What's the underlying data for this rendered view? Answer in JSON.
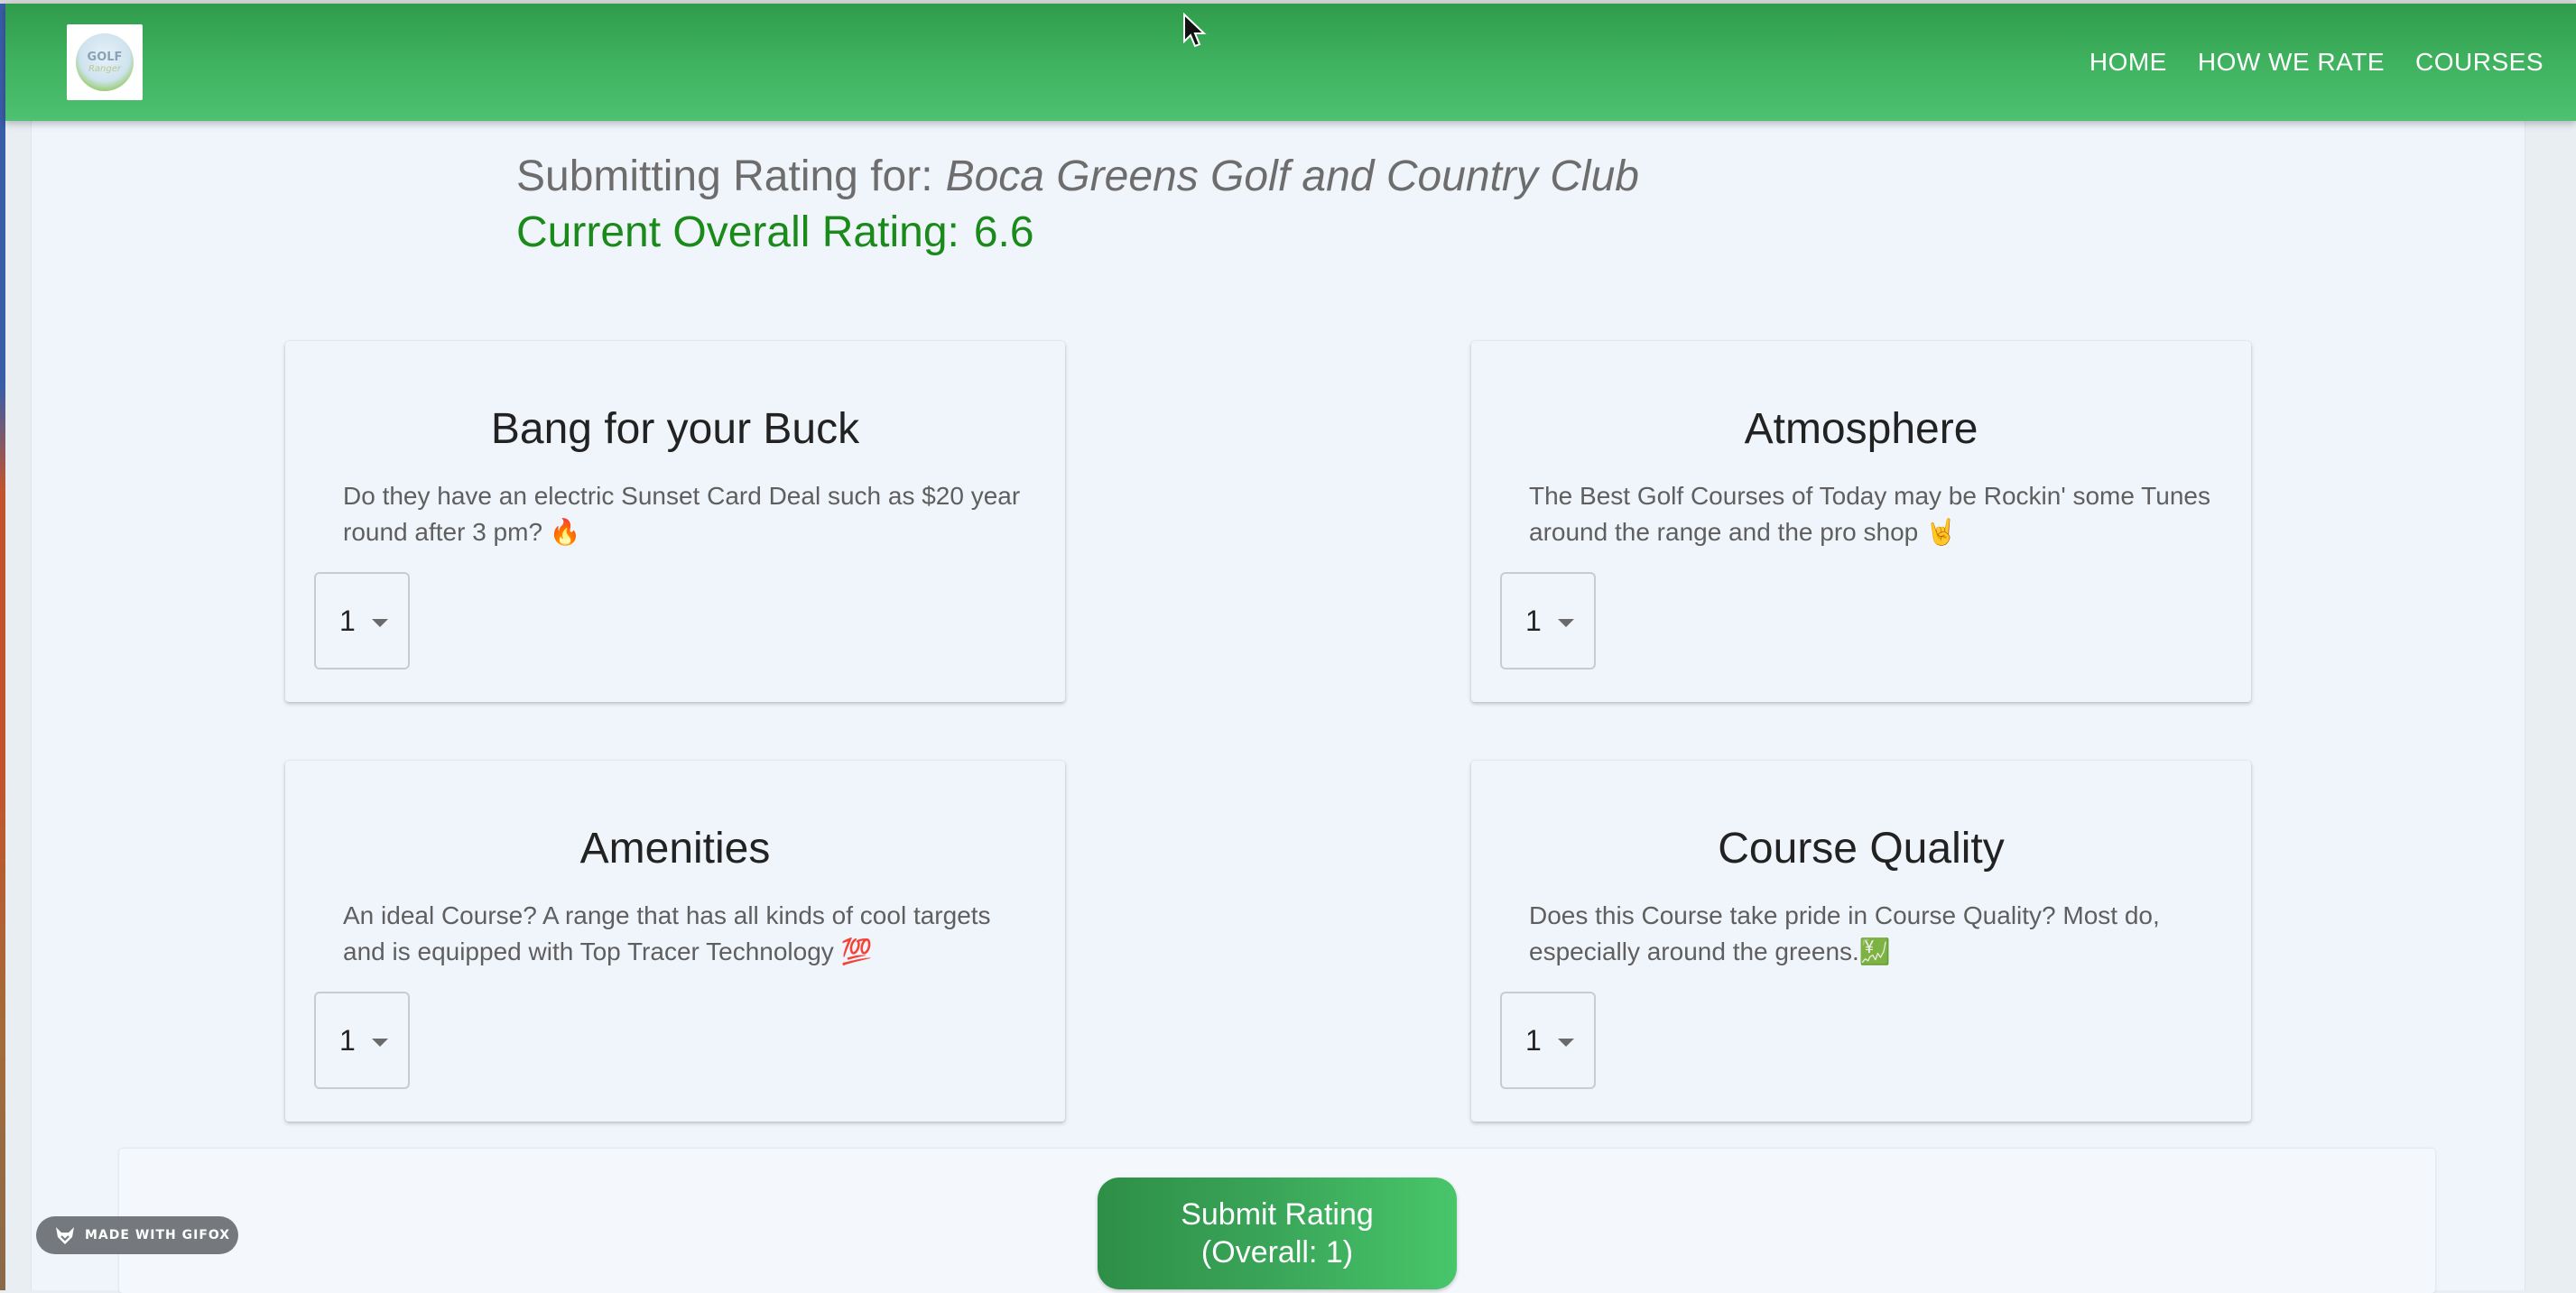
{
  "navbar": {
    "logo": {
      "line1": "GOLF",
      "line2": "Ranger"
    },
    "links": [
      "HOME",
      "HOW WE RATE",
      "COURSES"
    ]
  },
  "rating": {
    "submitting_label": "Submitting Rating for:",
    "course_name": "Boca Greens Golf and Country Club",
    "overall_label": "Current Overall Rating:",
    "overall_value": "6.6"
  },
  "categories": [
    {
      "title": "Bang for your Buck",
      "description": "Do they have an electric Sunset Card Deal such as $20 year round after 3 pm? 🔥",
      "selected": "1"
    },
    {
      "title": "Atmosphere",
      "description": "The Best Golf Courses of Today may be Rockin' some Tunes around the range and the pro shop 🤘",
      "selected": "1"
    },
    {
      "title": "Amenities",
      "description": "An ideal Course? A range that has all kinds of cool targets and is equipped with Top Tracer Technology 💯",
      "selected": "1"
    },
    {
      "title": "Course Quality",
      "description": "Does this Course take pride in Course Quality? Most do, especially around the greens.💹",
      "selected": "1"
    }
  ],
  "submit": {
    "line1": "Submit Rating",
    "line2": "(Overall:  1)"
  },
  "badge": {
    "label": "MADE WITH GIFOX"
  },
  "colors": {
    "nav_green": "#3fb25f",
    "overall_green": "#1a8a1a",
    "background": "#f0f5fb"
  }
}
